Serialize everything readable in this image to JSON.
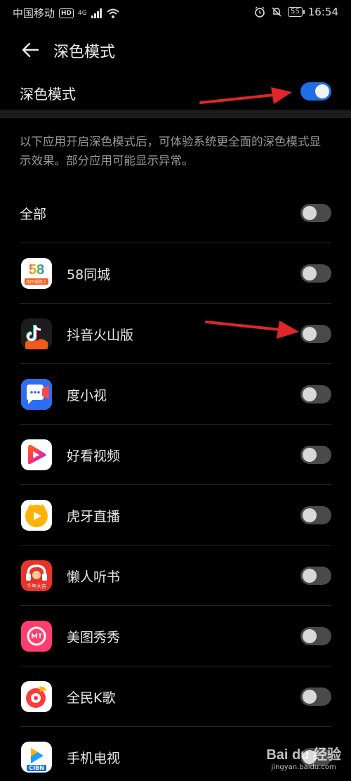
{
  "status_bar": {
    "carrier": "中国移动",
    "hd": "HD",
    "network": "4G",
    "battery": "55",
    "time": "16:54"
  },
  "header": {
    "title": "深色模式"
  },
  "dark_mode": {
    "label": "深色模式",
    "enabled": true
  },
  "description": "以下应用开启深色模式后，可体验系统更全面的深色模式显示效果。部分应用可能显示异常。",
  "all_row": {
    "label": "全部",
    "enabled": false
  },
  "apps": [
    {
      "name": "58同城",
      "icon": "58-tongcheng-icon",
      "enabled": false
    },
    {
      "name": "抖音火山版",
      "icon": "douyin-huoshan-icon",
      "enabled": false
    },
    {
      "name": "度小视",
      "icon": "duxiaoshi-icon",
      "enabled": false
    },
    {
      "name": "好看视频",
      "icon": "haokan-video-icon",
      "enabled": false
    },
    {
      "name": "虎牙直播",
      "icon": "huya-live-icon",
      "enabled": false
    },
    {
      "name": "懒人听书",
      "icon": "lanren-tingshu-icon",
      "enabled": false
    },
    {
      "name": "美图秀秀",
      "icon": "meitu-xiuxiu-icon",
      "enabled": false
    },
    {
      "name": "全民K歌",
      "icon": "quanmin-kge-icon",
      "enabled": false
    },
    {
      "name": "手机电视",
      "icon": "shouji-dianshi-icon",
      "enabled": false
    }
  ],
  "icon_text": {
    "app58_num": "58",
    "app58_sub": "找同城就上",
    "lanren_sub": "千年大吉",
    "cibn": "CIBN"
  },
  "watermark": {
    "main": "Bai du 经验",
    "sub": "jingyan.baidu.com"
  },
  "colors": {
    "accent": "#1e6ee8",
    "annotation_arrow": "#e0262a"
  }
}
